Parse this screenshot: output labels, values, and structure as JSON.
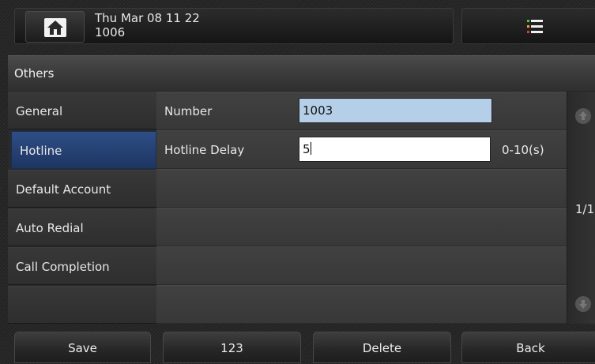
{
  "header": {
    "datetime": "Thu Mar 08 11 22",
    "extension": "1006"
  },
  "panel": {
    "title": "Others"
  },
  "sidebar": {
    "items": [
      {
        "label": "General"
      },
      {
        "label": "Hotline"
      },
      {
        "label": "Default Account"
      },
      {
        "label": "Auto Redial"
      },
      {
        "label": "Call Completion"
      },
      {
        "label": ""
      }
    ],
    "selected": "Hotline"
  },
  "form": {
    "number": {
      "label": "Number",
      "value": "1003"
    },
    "hotline_delay": {
      "label": "Hotline Delay",
      "value": "5",
      "range": "0-10(s)"
    }
  },
  "pager": {
    "text": "1/1"
  },
  "softkeys": {
    "save": "Save",
    "input_mode": "123",
    "delete": "Delete",
    "back": "Back"
  },
  "colors": {
    "selected_item": "#2a4a80",
    "number_field": "#b5cfe8",
    "menu_icon_dots": [
      "#3fd23f",
      "#f5a623",
      "#e53935"
    ]
  },
  "icons": {
    "home": "home-icon",
    "menu": "menu-list-icon",
    "scroll_up": "arrow-up-icon",
    "scroll_down": "arrow-down-icon"
  }
}
